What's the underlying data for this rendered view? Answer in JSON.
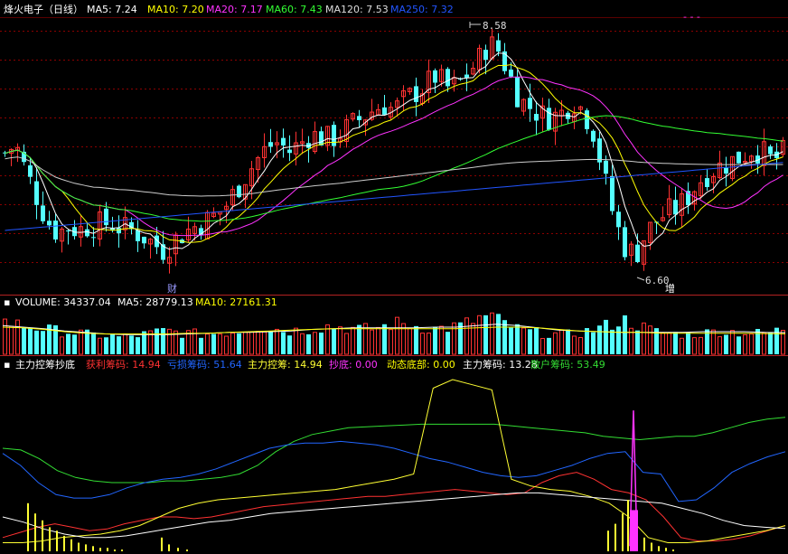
{
  "colors": {
    "bg": "#000000",
    "up": "#ff3232",
    "down": "#54ffff",
    "grid": "#8b0000",
    "border": "#b22222",
    "ma5": "#ffffff",
    "ma10": "#ffff00",
    "ma20": "#ff33ff",
    "ma60": "#33ff33",
    "ma120": "#cccccc",
    "ma250": "#2255ff",
    "profit": "#ff3232",
    "loss": "#2266ff",
    "main": "#ffff33",
    "bottom": "#ff33ff",
    "dyn": "#ffff00",
    "chip": "#ffffff",
    "retail": "#33dd33"
  },
  "price_header": {
    "title": "烽火电子（日线）",
    "items": [
      {
        "key": "ma5",
        "text": "MA5: 7.24"
      },
      {
        "key": "ma10",
        "text": "MA10: 7.20"
      },
      {
        "key": "ma20",
        "text": "MA20: 7.17"
      },
      {
        "key": "ma60",
        "text": "MA60: 7.43"
      },
      {
        "key": "ma120",
        "text": "MA120: 7.53"
      },
      {
        "key": "ma250",
        "text": "MA250: 7.32"
      }
    ]
  },
  "volume_header": {
    "items": [
      {
        "key": "vol",
        "text": "VOLUME: 34337.04"
      },
      {
        "key": "ma5",
        "text": "MA5: 28779.13"
      },
      {
        "key": "ma10",
        "text": "MA10: 27161.31"
      }
    ]
  },
  "indicator_header": {
    "title": "主力控筹抄底",
    "items": [
      {
        "key": "profit",
        "text": "获利筹码: 14.94"
      },
      {
        "key": "loss",
        "text": "亏损筹码: 51.64"
      },
      {
        "key": "main",
        "text": "主力控筹: 14.94"
      },
      {
        "key": "bottom",
        "text": "抄底: 0.00"
      },
      {
        "key": "dyn",
        "text": "动态底部: 0.00"
      },
      {
        "key": "chip",
        "text": "主力筹码: 13.28"
      },
      {
        "key": "retail",
        "text": "散户筹码: 53.49"
      }
    ]
  },
  "annotations": {
    "high": "8.58",
    "low": "6.60",
    "fin": "财",
    "inc": "增"
  },
  "chart_data": [
    {
      "type": "candlestick",
      "title": "烽火电子（日线）",
      "ylim": [
        6.5,
        8.65
      ],
      "high": 8.58,
      "low": 6.6,
      "price_path": [
        7.55,
        7.62,
        7.4,
        7.2,
        7.0,
        6.9,
        6.95,
        6.92,
        6.96,
        6.97,
        6.98,
        6.94,
        6.92,
        6.88,
        6.82,
        6.76,
        6.83,
        6.9,
        6.95,
        6.99,
        7.04,
        7.12,
        7.25,
        7.38,
        7.5,
        7.6,
        7.64,
        7.56,
        7.62,
        7.7,
        7.68,
        7.66,
        7.72,
        7.78,
        7.84,
        7.9,
        7.95,
        7.9,
        7.98,
        8.04,
        8.1,
        8.18,
        8.08,
        8.1,
        8.2,
        8.3,
        8.45,
        8.38,
        8.18,
        7.98,
        7.92,
        7.86,
        7.84,
        7.88,
        7.98,
        7.9,
        7.72,
        7.35,
        7.0,
        6.78,
        6.72,
        6.9,
        7.0,
        7.07,
        7.1,
        7.2,
        7.32,
        7.4,
        7.44,
        7.48,
        7.52,
        7.58,
        7.56,
        7.48,
        7.55
      ]
    },
    {
      "type": "bar",
      "title": "VOLUME",
      "series": [
        {
          "name": "VOLUME",
          "values": [
            43000,
            40000,
            38000,
            36000,
            33000,
            31000,
            30000,
            28000,
            26000,
            25000,
            24000,
            23000,
            24000,
            26000,
            28000,
            31000,
            30000,
            28000,
            27000,
            27000,
            28000,
            29000,
            31000,
            34000,
            37000,
            35000,
            33000,
            31000,
            32000,
            34000,
            36000,
            38000,
            36000,
            34000,
            33000,
            34000,
            37000,
            41000,
            40000,
            38000,
            35000,
            34000,
            35000,
            37000,
            41000,
            47000,
            51000,
            44000,
            38000,
            32000,
            30000,
            28000,
            27000,
            26000,
            27000,
            29000,
            33000,
            37000,
            42000,
            45000,
            40000,
            34000,
            30000,
            28000,
            27000,
            26000,
            27000,
            29000,
            31000,
            30000,
            29000,
            28000,
            28000,
            29000,
            34337
          ]
        },
        {
          "name": "MA5",
          "values": [
            38000,
            36000,
            34000,
            31000,
            29000,
            27000,
            26000,
            26000,
            26000,
            27000,
            28000,
            29000,
            29000,
            30000,
            31000,
            33000,
            34000,
            35000,
            35000,
            35000,
            35000,
            36000,
            36000,
            38000,
            40000,
            38000,
            35000,
            32000,
            31000,
            30000,
            29000,
            29000,
            29000,
            29000,
            30000,
            30000,
            30000,
            29000,
            28779
          ]
        },
        {
          "name": "MA10",
          "values": [
            36000,
            35000,
            33000,
            30000,
            28000,
            27000,
            27000,
            27000,
            27000,
            28000,
            28000,
            29000,
            30000,
            31000,
            32000,
            33000,
            34000,
            34000,
            34000,
            34000,
            34000,
            34000,
            34000,
            35000,
            36000,
            36000,
            35000,
            33000,
            31000,
            30000,
            29000,
            29000,
            28000,
            28000,
            28000,
            28000,
            28000,
            27500,
            27161
          ]
        }
      ],
      "ylim": [
        0,
        60000
      ]
    },
    {
      "type": "line",
      "title": "主力控筹抄底",
      "ylim": [
        0,
        100
      ],
      "series": [
        {
          "name": "散户筹码",
          "values": [
            60,
            59,
            54,
            47,
            43,
            41,
            40,
            40,
            40,
            41,
            41,
            42,
            43,
            45,
            50,
            58,
            64,
            68,
            70,
            72,
            72.5,
            73,
            73.5,
            74,
            74,
            74,
            74,
            74,
            73,
            72,
            71,
            70,
            69,
            67,
            66,
            65,
            66,
            67,
            67,
            69,
            72,
            75,
            77,
            78
          ]
        },
        {
          "name": "亏损筹码",
          "values": [
            57,
            50,
            40,
            33,
            31,
            31,
            33,
            37,
            40,
            42,
            43,
            45,
            48,
            52,
            56,
            60,
            62,
            63,
            63,
            64,
            63,
            62,
            60,
            57,
            54,
            52,
            49,
            46,
            44,
            43,
            44,
            47,
            50,
            54,
            57,
            58,
            46,
            45,
            29,
            30,
            37,
            46,
            51,
            55,
            58
          ]
        },
        {
          "name": "获利筹码",
          "values": [
            8,
            11,
            14,
            16,
            14,
            12,
            13,
            16,
            18,
            20,
            20,
            19,
            20,
            22,
            24,
            26,
            27,
            28,
            29,
            30,
            31,
            32,
            32,
            33,
            34,
            35,
            36,
            35,
            34,
            33,
            34,
            40,
            44,
            46,
            42,
            36,
            34,
            30,
            20,
            8,
            6,
            6,
            7,
            9,
            12,
            15
          ]
        },
        {
          "name": "主力控筹",
          "values": [
            5,
            5,
            6,
            8,
            9,
            10,
            12,
            15,
            20,
            25,
            28,
            30,
            31,
            32,
            33,
            34,
            35,
            36,
            38,
            40,
            42,
            45,
            95,
            100,
            97,
            94,
            42,
            38,
            36,
            35,
            32,
            28,
            20,
            8,
            5,
            5,
            6,
            8,
            10,
            12,
            14.94
          ]
        },
        {
          "name": "主力筹码",
          "values": [
            20,
            17,
            13,
            10,
            8,
            8,
            9,
            11,
            13,
            15,
            17,
            18,
            20,
            22,
            23,
            24,
            25,
            26,
            27,
            28,
            29,
            30,
            31,
            32,
            33,
            34,
            34,
            33,
            32,
            31,
            30,
            29,
            28,
            25,
            22,
            18,
            15,
            14,
            13.28
          ]
        }
      ]
    }
  ]
}
